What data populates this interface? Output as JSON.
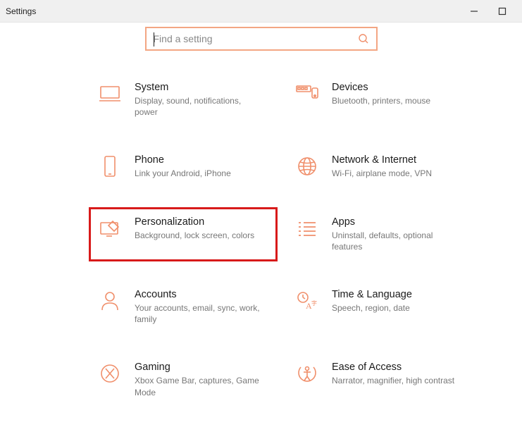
{
  "window": {
    "title": "Settings"
  },
  "search": {
    "placeholder": "Find a setting"
  },
  "tiles": {
    "system": {
      "title": "System",
      "sub": "Display, sound, notifications, power"
    },
    "devices": {
      "title": "Devices",
      "sub": "Bluetooth, printers, mouse"
    },
    "phone": {
      "title": "Phone",
      "sub": "Link your Android, iPhone"
    },
    "network": {
      "title": "Network & Internet",
      "sub": "Wi-Fi, airplane mode, VPN"
    },
    "personalization": {
      "title": "Personalization",
      "sub": "Background, lock screen, colors"
    },
    "apps": {
      "title": "Apps",
      "sub": "Uninstall, defaults, optional features"
    },
    "accounts": {
      "title": "Accounts",
      "sub": "Your accounts, email, sync, work, family"
    },
    "time": {
      "title": "Time & Language",
      "sub": "Speech, region, date"
    },
    "gaming": {
      "title": "Gaming",
      "sub": "Xbox Game Bar, captures, Game Mode"
    },
    "ease": {
      "title": "Ease of Access",
      "sub": "Narrator, magnifier, high contrast"
    }
  }
}
